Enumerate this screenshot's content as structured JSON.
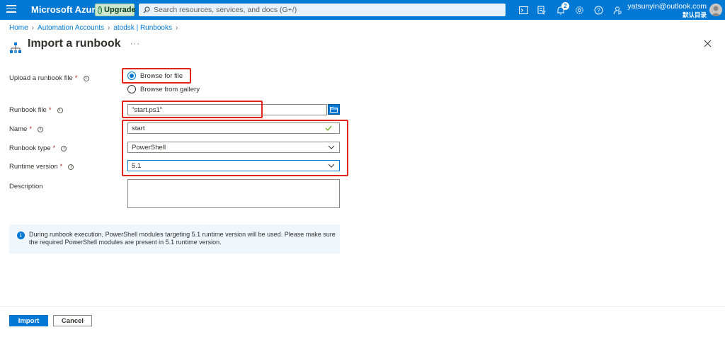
{
  "topbar": {
    "brand": "Microsoft Azure",
    "upgrade_label": "Upgrade",
    "search_placeholder": "Search resources, services, and docs (G+/)",
    "notification_count": "2",
    "account_email": "yatsunyin@outlook.com",
    "account_directory": "默认目录"
  },
  "breadcrumb": {
    "items": [
      "Home",
      "Automation Accounts",
      "atodsk | Runbooks"
    ]
  },
  "page": {
    "title": "Import a runbook",
    "more": "···"
  },
  "form": {
    "upload_label": "Upload a runbook file",
    "upload_options": [
      "Browse for file",
      "Browse from gallery"
    ],
    "runbook_file_label": "Runbook file",
    "runbook_file_value": "\"start.ps1\"",
    "name_label": "Name",
    "name_value": "start",
    "type_label": "Runbook type",
    "type_value": "PowerShell",
    "runtime_label": "Runtime version",
    "runtime_value": "5.1",
    "description_label": "Description",
    "description_value": "",
    "required_mark": "*"
  },
  "banner": {
    "icon_text": "i",
    "text": "During runbook execution, PowerShell modules targeting 5.1 runtime version will be used. Please make sure the required PowerShell modules are present in 5.1 runtime version."
  },
  "footer": {
    "import_label": "Import",
    "cancel_label": "Cancel"
  },
  "colors": {
    "brand_blue": "#0078d4",
    "highlight_red": "#e2241a",
    "banner_bg": "#eff6fc",
    "upgrade_bg": "#cce6cf"
  },
  "icons": [
    "hamburger-icon",
    "upgrade-icon",
    "search-icon",
    "cloud-shell-icon",
    "directory-filter-icon",
    "notifications-icon",
    "settings-icon",
    "help-icon",
    "feedback-icon",
    "runbook-icon",
    "close-icon",
    "info-icon",
    "folder-icon",
    "chevron-down-icon",
    "checkmark-icon"
  ]
}
